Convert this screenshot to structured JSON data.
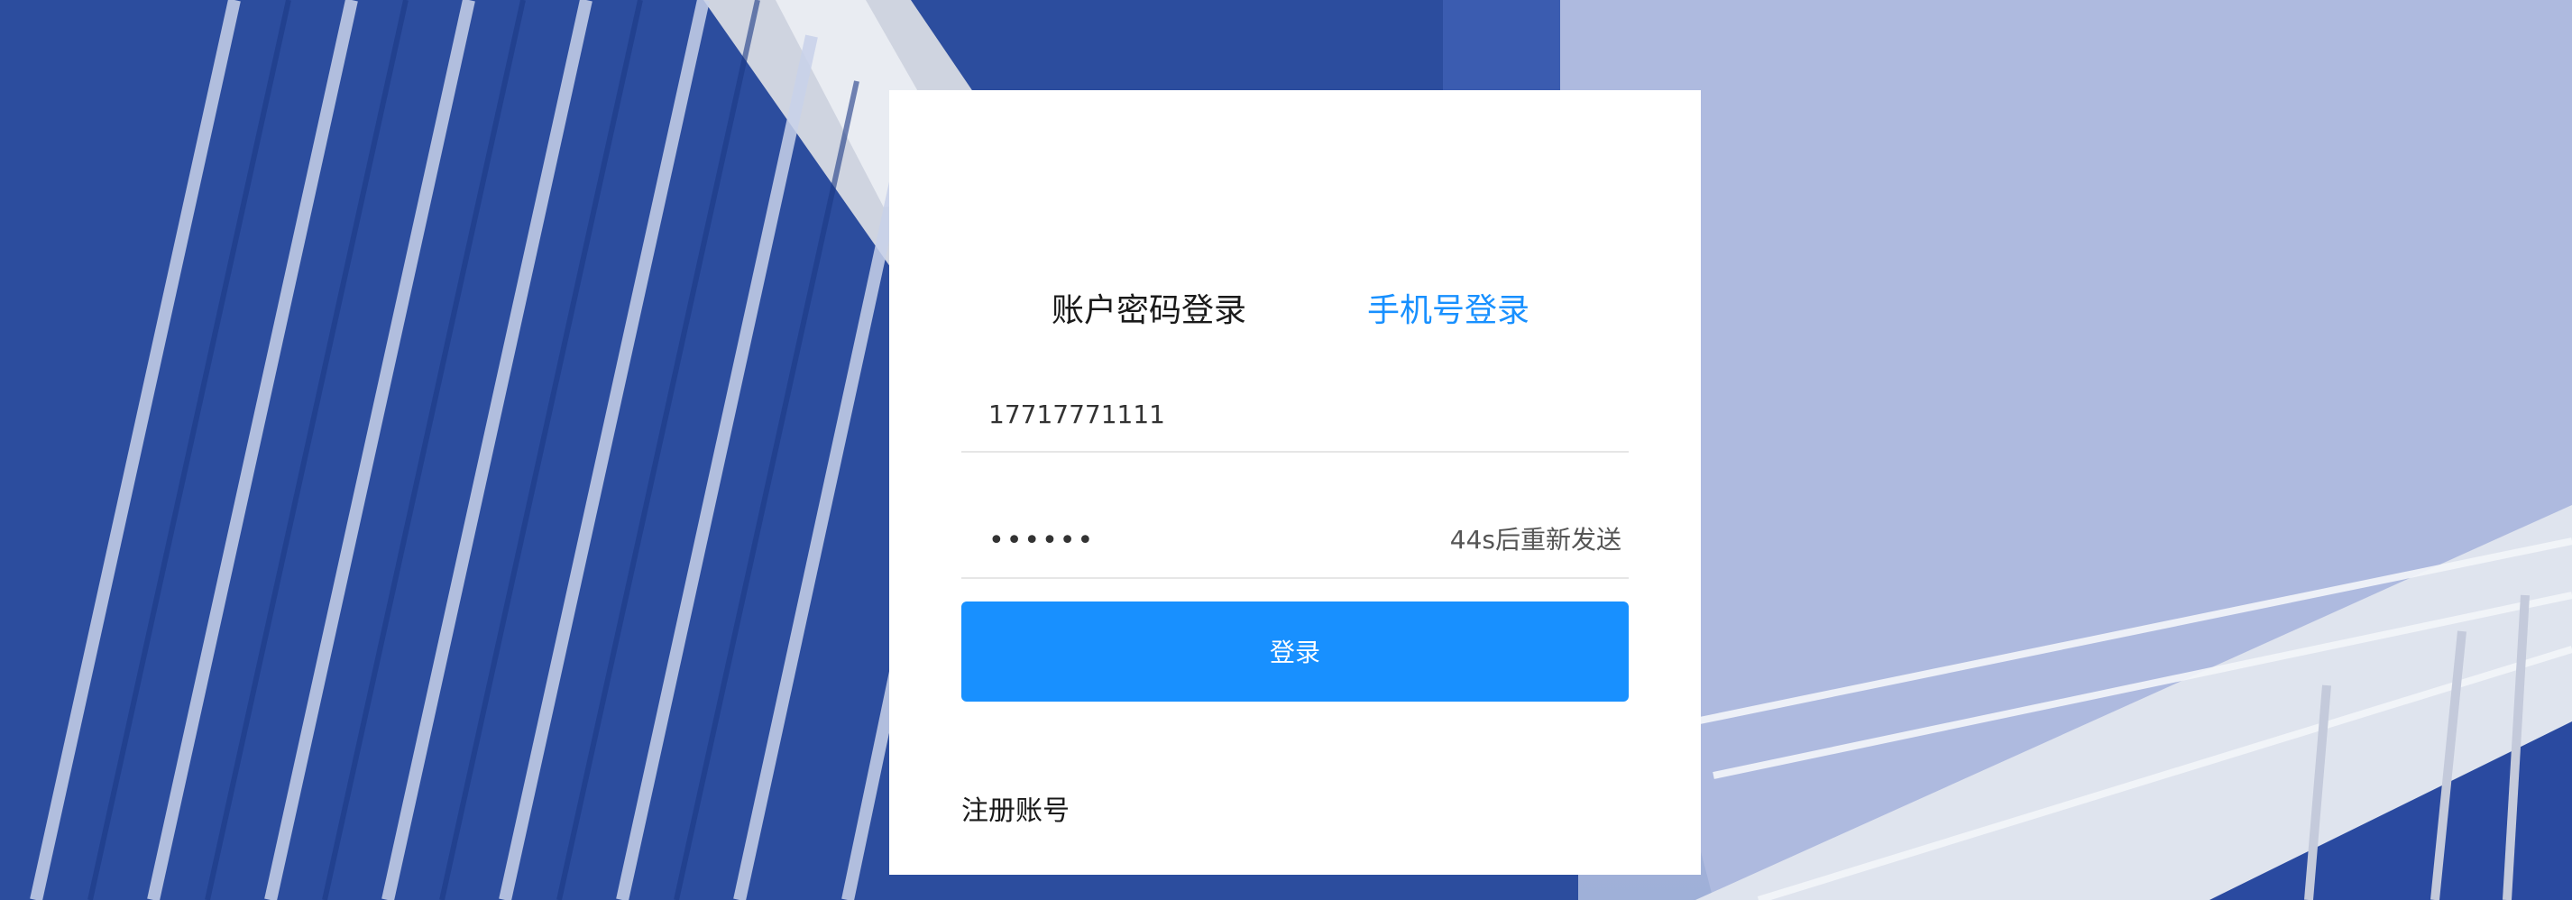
{
  "login": {
    "tabs": [
      {
        "label": "账户密码登录",
        "active": false
      },
      {
        "label": "手机号登录",
        "active": true
      }
    ],
    "phone": {
      "value": "17717771111"
    },
    "code": {
      "value": "••••••",
      "resend_label": "44s后重新发送"
    },
    "submit_label": "登录",
    "register_label": "注册账号"
  },
  "colors": {
    "accent": "#1890ff",
    "background_sky": "#b3bfe0",
    "building_blue": "#2a4aa0"
  }
}
